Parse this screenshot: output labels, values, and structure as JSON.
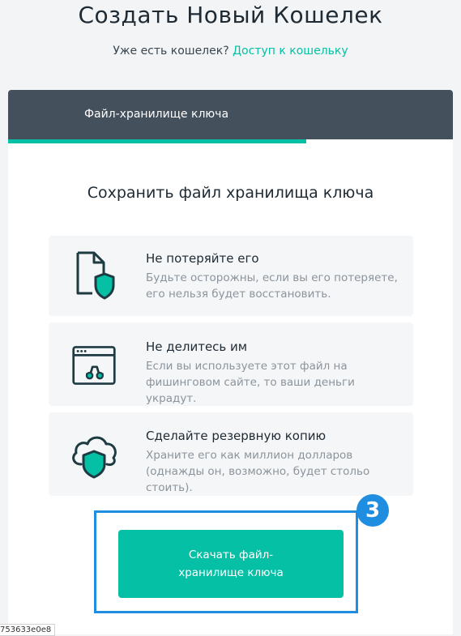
{
  "page": {
    "title": "Создать Новый Кошелек",
    "subtitle_prefix": "Уже есть кошелек?",
    "subtitle_link": "Доступ к кошельку"
  },
  "tab": {
    "label": "Файл-хранилище ключа",
    "progress_percent": 67
  },
  "section": {
    "heading": "Сохранить файл хранилища ключа"
  },
  "tips": [
    {
      "icon": "file-shield-icon",
      "title": "Не потеряйте его",
      "text": "Будьте осторожны, если вы его потеряете, его нельзя будет восстановить."
    },
    {
      "icon": "phishing-browser-icon",
      "title": "Не делитесь им",
      "text": "Если вы используете этот файл на фишинговом сайте, то ваши деньги украдут."
    },
    {
      "icon": "cloud-shield-icon",
      "title": "Сделайте резервную копию",
      "text": "Храните его как миллион долларов (однажды он, возможно, будет стольо стоить)."
    }
  ],
  "download": {
    "label": "Скачать файл-хранилище ключа",
    "step_badge": "3"
  },
  "corner_id": "753633e0e8",
  "colors": {
    "accent": "#05c0a5",
    "tabbar": "#45505d",
    "highlight": "#1f8de0",
    "icon_stroke": "#1e3a42"
  }
}
